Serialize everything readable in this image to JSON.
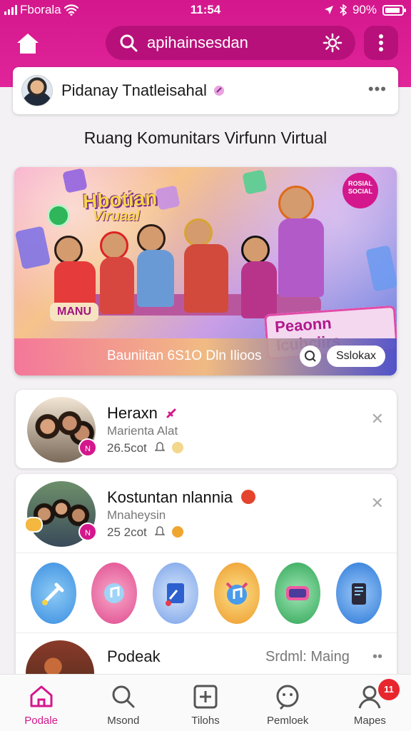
{
  "status_bar": {
    "carrier": "Fborala",
    "time": "11:54",
    "battery": "90%"
  },
  "header": {
    "search_value": "apihainsesdan"
  },
  "profile": {
    "name": "Pidanay Tnatleisahal"
  },
  "page_title": "Ruang Komunitars Virfunn Virtual",
  "banner": {
    "title": "Hbotian",
    "subtitle": "Viruaal",
    "corner_badge": "ROSIAL SOCIAL",
    "left_label": "MANU",
    "ribbon": "Peaonn Icuhciirs",
    "caption": "Bauniitan 6S1O Dln Ilioos",
    "pill_button": "Sslokax"
  },
  "communities": [
    {
      "title": "Heraxn",
      "subtitle": "Marienta Alat",
      "meta": "26.5cot",
      "badge": "N"
    },
    {
      "title": "Kostuntan nlannia",
      "subtitle": "Mnaheysin",
      "meta": "25 2cot",
      "badge": "N"
    }
  ],
  "apps": [
    {
      "name": "brush-app-icon",
      "color": "#5aa3e8"
    },
    {
      "name": "music-app-icon",
      "color": "#f06fa6"
    },
    {
      "name": "book-app-icon",
      "color": "#8fb6ef"
    },
    {
      "name": "music-note-app-icon",
      "color": "#f4c24a"
    },
    {
      "name": "games-app-icon",
      "color": "#4dbf68"
    },
    {
      "name": "device-app-icon",
      "color": "#3c8ee6"
    }
  ],
  "third_card": {
    "title": "Podeak",
    "right_text": "Srdml: Maing"
  },
  "bottom_nav": [
    {
      "label": "Podale",
      "icon": "home-icon",
      "active": true
    },
    {
      "label": "Msond",
      "icon": "search-icon",
      "active": false
    },
    {
      "label": "Tilohs",
      "icon": "add-icon",
      "active": false
    },
    {
      "label": "Pemloek",
      "icon": "chat-icon",
      "active": false
    },
    {
      "label": "Mapes",
      "icon": "profile-icon",
      "active": false,
      "badge": "11"
    }
  ],
  "colors": {
    "primary": "#d4178c",
    "accent_dark": "#b8107a",
    "notification": "#e8262e"
  }
}
